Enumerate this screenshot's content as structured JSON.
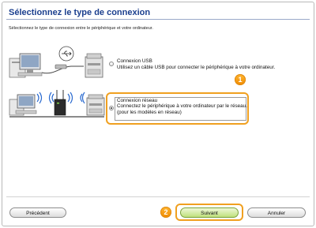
{
  "header": {
    "title": "Sélectionnez le type de connexion",
    "subtitle": "Sélectionnez le type de connexion entre le périphérique et votre ordinateur."
  },
  "options": [
    {
      "label": "Connexion USB",
      "description": "Utilisez un câble USB pour connecter le périphérique à votre ordinateur.",
      "selected": false
    },
    {
      "label": "Connexion réseau",
      "description_line1": "Connectez le périphérique à votre ordinateur par le réseau.",
      "description_line2": "(pour les modèles en réseau)",
      "selected": true
    }
  ],
  "steps": {
    "one": "1",
    "two": "2"
  },
  "buttons": {
    "previous": "Précédent",
    "next": "Suivant",
    "cancel": "Annuler"
  },
  "icons": {
    "usb": "usb-icon",
    "wifi": "wifi-icon"
  },
  "colors": {
    "title": "#1b3f8e",
    "highlight": "#f0a020",
    "next_button": "#bfe07c",
    "wifi": "#2a6ad0"
  }
}
